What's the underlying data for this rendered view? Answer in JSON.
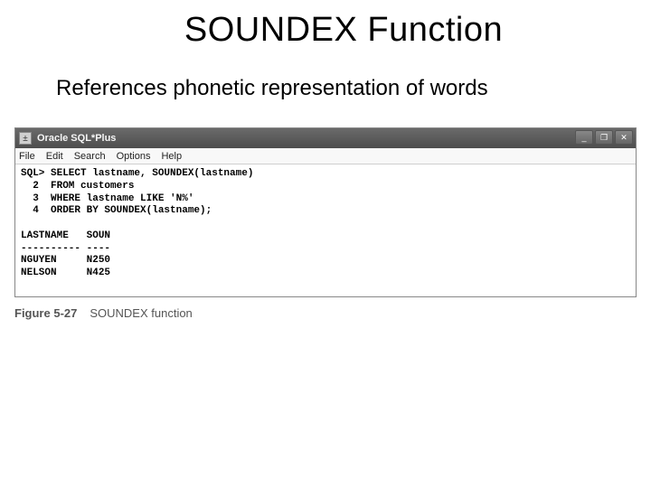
{
  "slide": {
    "title": "SOUNDEX Function",
    "subtitle": "References phonetic representation of words"
  },
  "window": {
    "app_title": "Oracle SQL*Plus",
    "menu": {
      "file": "File",
      "edit": "Edit",
      "search": "Search",
      "options": "Options",
      "help": "Help"
    },
    "buttons": {
      "min": "_",
      "max": "❐",
      "close": "✕"
    }
  },
  "terminal": {
    "prompt": "SQL>",
    "line1": "SQL> SELECT lastname, SOUNDEX(lastname)",
    "line2": "  2  FROM customers",
    "line3": "  3  WHERE lastname LIKE 'N%'",
    "line4": "  4  ORDER BY SOUNDEX(lastname);",
    "blank": "",
    "header": "LASTNAME   SOUN",
    "divider": "---------- ----",
    "row1": "NGUYEN     N250",
    "row2": "NELSON     N425"
  },
  "chart_data": {
    "type": "table",
    "title": "SOUNDEX function output",
    "columns": [
      "LASTNAME",
      "SOUN"
    ],
    "rows": [
      [
        "NGUYEN",
        "N250"
      ],
      [
        "NELSON",
        "N425"
      ]
    ],
    "query": "SELECT lastname, SOUNDEX(lastname) FROM customers WHERE lastname LIKE 'N%' ORDER BY SOUNDEX(lastname);"
  },
  "caption": {
    "label": "Figure 5-27",
    "text": "SOUNDEX function"
  }
}
